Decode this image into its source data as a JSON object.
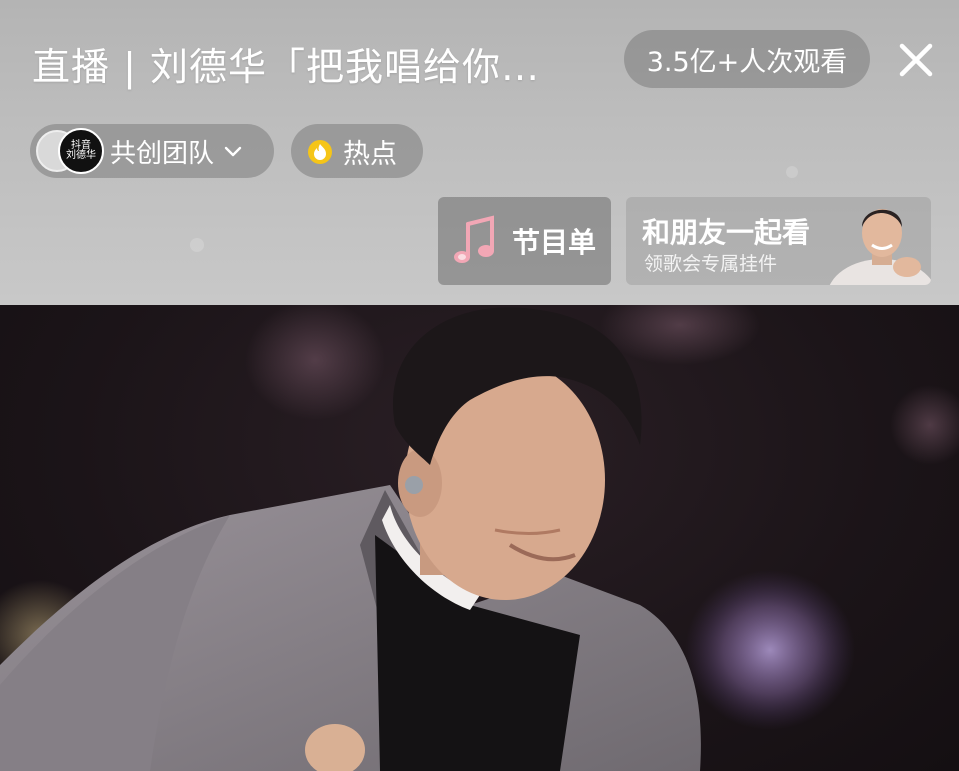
{
  "header": {
    "title": "直播 | 刘德华「把我唱给你…",
    "views": "3.5亿+人次观看",
    "close_icon": "close-icon"
  },
  "chips": {
    "team_label": "共创团队",
    "team_avatar_text_top": "抖音",
    "team_avatar_text_bottom": "刘德华",
    "hot_label": "热点",
    "hot_icon_color": "#f5c518"
  },
  "actions": {
    "program_label": "节目单",
    "together_title": "和朋友一起看",
    "together_subtitle": "领歌会专属挂件"
  },
  "colors": {
    "music_note_pink": "#f2a7b5",
    "suit_gray": "#8d878c",
    "stage_dark": "#1b1418"
  }
}
